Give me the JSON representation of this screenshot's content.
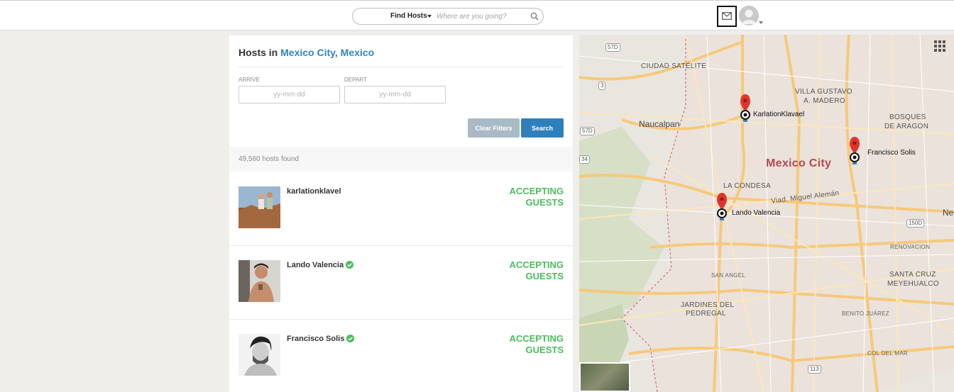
{
  "header": {
    "search_dropdown_label": "Find Hosts",
    "search_placeholder": "Where are you going?",
    "icons": [
      "search-icon",
      "mail-icon",
      "avatar-icon"
    ]
  },
  "panel": {
    "title_prefix": "Hosts in",
    "title_location": "Mexico City, Mexico",
    "arrive_label": "ARRIVE",
    "depart_label": "DEPART",
    "arrive_placeholder": "yy-mm-dd",
    "depart_placeholder": "yy-mm-dd",
    "clear_filters_label": "Clear Filters",
    "search_label": "Search",
    "hosts_found": "49,560 hosts found",
    "hosts": [
      {
        "name": "karlationklavel",
        "verified": false,
        "status_line1": "ACCEPTING",
        "status_line2": "GUESTS"
      },
      {
        "name": "Lando Valencia",
        "verified": true,
        "status_line1": "ACCEPTING",
        "status_line2": "GUESTS"
      },
      {
        "name": "Francisco Solis",
        "verified": true,
        "status_line1": "ACCEPTING",
        "status_line2": "GUESTS"
      }
    ]
  },
  "map": {
    "labels": {
      "ciudad_satelite": "CIUDAD SATÉLITE",
      "villa_gustavo": "VILLA GUSTAVO",
      "a_madero": "A. MADERO",
      "naucalpan": "Naucalpan",
      "bosques": "BOSQUES",
      "de_aragon": "DE ARAGON",
      "mexico_city": "Mexico City",
      "la_condesa": "LA CONDESA",
      "viad": "Viad. Miguel Alemán",
      "ne": "Ne",
      "renovacion": "RENOVACION",
      "san_angel": "SAN ANGEL",
      "santa_cruz": "SANTA CRUZ",
      "meyehualco": "MEYEHUALCO",
      "jardines_del": "JARDINES DEL",
      "pedregal": "PEDREGAL",
      "benito_juarez": "BENITO JUÁREZ",
      "col_del_mar": "COL DEL MAR"
    },
    "shields": {
      "s57d_a": "57D",
      "s57d_b": "57D",
      "s3": "3",
      "s34": "34",
      "s150d": "150D",
      "s113": "113"
    },
    "markers": [
      {
        "label": "KarlationKlavael"
      },
      {
        "label": "Francisco Solis"
      },
      {
        "label": "Lando Valencia"
      }
    ],
    "colors": {
      "land": "#ebe2dc",
      "roads": "#f6c97a",
      "marker": "#e0352b"
    }
  }
}
